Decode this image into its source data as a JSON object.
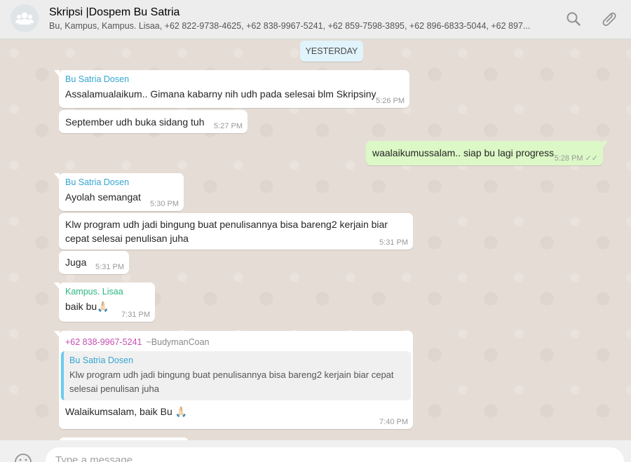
{
  "header": {
    "title": "Skripsi |Dospem Bu Satria",
    "subtitle": "Bu, Kampus, Kampus. Lisaa, +62 822-9738-4625, +62 838-9967-5241, +62 859-7598-3895, +62 896-6833-5044, +62 897..."
  },
  "chat": {
    "date_chip": "YESTERDAY",
    "messages": [
      {
        "sender": "Bu Satria Dosen",
        "sender_color": "#35a5d1",
        "text": "Assalamualaikum.. Gimana kabarny nih udh pada selesai blm Skripsiny",
        "time": "5:26 PM"
      },
      {
        "text": "September udh buka sidang tuh",
        "time": "5:27 PM"
      },
      {
        "text": "waalaikumussalam.. siap bu lagi progress",
        "time": "5:28 PM"
      },
      {
        "sender": "Bu Satria Dosen",
        "sender_color": "#35a5d1",
        "text": "Ayolah semangat",
        "time": "5:30 PM"
      },
      {
        "text": "Klw program udh jadi bingung buat penulisannya bisa bareng2 kerjain biar cepat selesai penulisan juha",
        "time": "5:31 PM"
      },
      {
        "text": "Juga",
        "time": "5:31 PM"
      },
      {
        "sender": "Kampus. Lisaa",
        "sender_color": "#2ab580",
        "text": "baik bu🙏🏻",
        "time": "7:31 PM"
      },
      {
        "phone": "+62 838-9967-5241",
        "alias": "~BudymanCoan",
        "quote_sender": "Bu Satria Dosen",
        "quote_text": "Klw program udh jadi bingung buat penulisannya bisa bareng2 kerjain biar cepat selesai penulisan juha",
        "text": "Walaikumsalam, baik Bu 🙏🏻",
        "time": "7:40 PM"
      }
    ]
  },
  "composer": {
    "placeholder": "Type a message"
  },
  "icons": {
    "search": "search-icon",
    "attach": "paperclip-icon",
    "emoji": "emoji-icon",
    "avatar": "group-avatar-icon",
    "read": "double-check-icon"
  }
}
